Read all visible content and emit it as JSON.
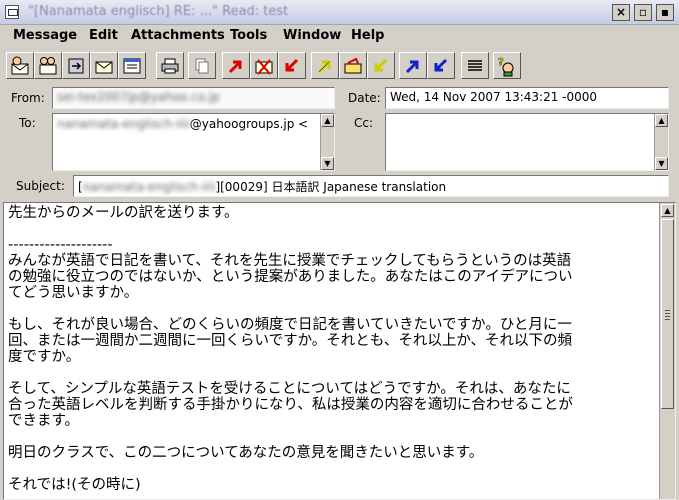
{
  "window": {
    "title": "\"[Nanamata englisch] RE: ...\" Read: test",
    "minimize_glyph": "×",
    "close_glyph": "×",
    "restore_glyph": "▫",
    "maximize_glyph": "▪"
  },
  "menu": [
    {
      "label": "Message"
    },
    {
      "label": "Edit"
    },
    {
      "label": "Attachments"
    },
    {
      "label": "Tools"
    },
    {
      "label": "Window"
    },
    {
      "label": "Help"
    }
  ],
  "toolbar": {
    "icons": [
      "reply-icon",
      "reply-all-icon",
      "forward-icon",
      "mail-icon",
      "compose-icon",
      "print-icon",
      "copy-icon",
      "prev-red-icon",
      "delete-icon",
      "next-red-icon",
      "prev-yellow-icon",
      "mark-yellow-icon",
      "next-yellow-icon",
      "prev-blue-icon",
      "next-blue-icon",
      "headers-icon",
      "help-icon"
    ]
  },
  "header": {
    "from_label": "From:",
    "from_value": "sei-tex2007jp@yahoo.co.jp",
    "date_label": "Date:",
    "date_value": "Wed, 14 Nov 2007 13:43:21 -0000",
    "to_label": "To:",
    "to_value_hidden": "nanamata-englisch-iiii",
    "to_value_visible": "@yahoogroups.jp <",
    "cc_label": "Cc:",
    "subject_label": "Subject:",
    "subject_open": "[",
    "subject_hidden": "nanamata-englisch-iiii",
    "subject_rest": "][00029] 日本語訳 Japanese translation"
  },
  "body": {
    "text": "先生からのメールの訳を送ります。\n\n--------------------\nみんなが英語で日記を書いて、それを先生に授業でチェックしてもらうというのは英語\nの勉強に役立つのではないか、という提案がありました。あなたはこのアイデアについ\nてどう思いますか。\n\nもし、それが良い場合、どのくらいの頻度で日記を書いていきたいですか。ひと月に一\n回、または一週間か二週間に一回くらいですか。それとも、それ以上か、それ以下の頻\n度ですか。\n\nそして、シンプルな英語テストを受けることについてはどうですか。それは、あなたに\n合った英語レベルを判断する手掛かりになり、私は授業の内容を適切に合わせることが\nできます。\n\n明日のクラスで、この二つについてあなたの意見を聞きたいと思います。\n\nそれでは!(その時に)"
  }
}
